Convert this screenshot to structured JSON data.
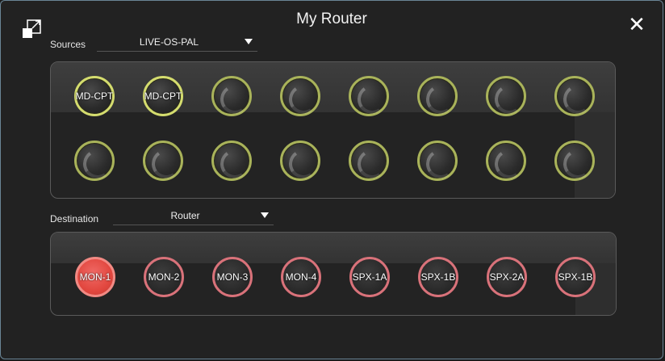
{
  "window": {
    "title": "My Router"
  },
  "icons": {
    "expand": "expand-icon",
    "close": "close-icon"
  },
  "sources": {
    "label": "Sources",
    "selected": "LIVE-OS-PAL",
    "buttons": [
      {
        "label": "MD-CPT",
        "active": true
      },
      {
        "label": "MD-CPT",
        "active": true
      },
      {
        "label": "",
        "active": false
      },
      {
        "label": "",
        "active": false
      },
      {
        "label": "",
        "active": false
      },
      {
        "label": "",
        "active": false
      },
      {
        "label": "",
        "active": false
      },
      {
        "label": "",
        "active": false
      },
      {
        "label": "",
        "active": false
      },
      {
        "label": "",
        "active": false
      },
      {
        "label": "",
        "active": false
      },
      {
        "label": "",
        "active": false
      },
      {
        "label": "",
        "active": false
      },
      {
        "label": "",
        "active": false
      },
      {
        "label": "",
        "active": false
      },
      {
        "label": "",
        "active": false
      }
    ]
  },
  "destination": {
    "label": "Destination",
    "selected": "Router",
    "buttons": [
      {
        "label": "MON-1",
        "on": true
      },
      {
        "label": "MON-2",
        "on": false
      },
      {
        "label": "MON-3",
        "on": false
      },
      {
        "label": "MON-4",
        "on": false
      },
      {
        "label": "SPX-1A",
        "on": false
      },
      {
        "label": "SPX-1B",
        "on": false
      },
      {
        "label": "SPX-2A",
        "on": false
      },
      {
        "label": "SPX-1B",
        "on": false
      }
    ]
  },
  "colors": {
    "source_ring": "#a9b35a",
    "source_ring_active": "#d4dc6e",
    "destination_ring": "#d9727a",
    "destination_on": "#e2473f",
    "window_border": "#6a8596"
  }
}
